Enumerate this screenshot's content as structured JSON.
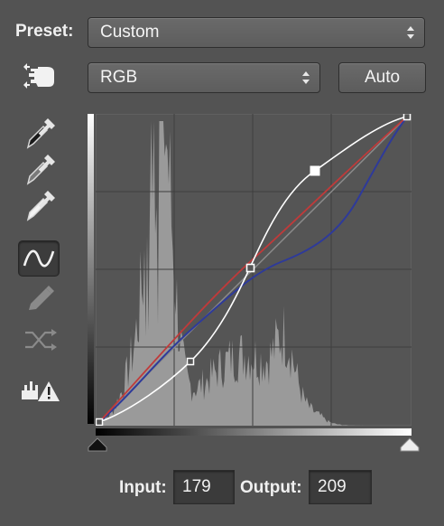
{
  "preset": {
    "label": "Preset:",
    "value": "Custom"
  },
  "channel": {
    "value": "RGB"
  },
  "auto_button": {
    "label": "Auto"
  },
  "tools": [
    {
      "name": "on-image-adjust-icon"
    },
    {
      "name": "black-point-eyedropper-icon"
    },
    {
      "name": "gray-point-eyedropper-icon"
    },
    {
      "name": "white-point-eyedropper-icon"
    },
    {
      "name": "curve-point-tool-icon",
      "selected": true
    },
    {
      "name": "pencil-draw-icon"
    },
    {
      "name": "smooth-curve-icon"
    },
    {
      "name": "clipping-warning-icon"
    }
  ],
  "input": {
    "label": "Input:",
    "value": "179"
  },
  "output": {
    "label": "Output:",
    "value": "209"
  },
  "colors": {
    "composite_curve": "#ffffff",
    "red_curve": "#c03a3a",
    "blue_curve": "#2e3a9a",
    "baseline": "#8a8a8a",
    "histogram": "#9a9a9a",
    "graph_bg": "#555555"
  },
  "curves": {
    "rgb_points": [
      [
        0,
        0
      ],
      [
        64,
        45
      ],
      [
        128,
        128
      ],
      [
        178,
        209
      ],
      [
        255,
        255
      ]
    ],
    "selected_point": [
      178,
      209
    ]
  }
}
